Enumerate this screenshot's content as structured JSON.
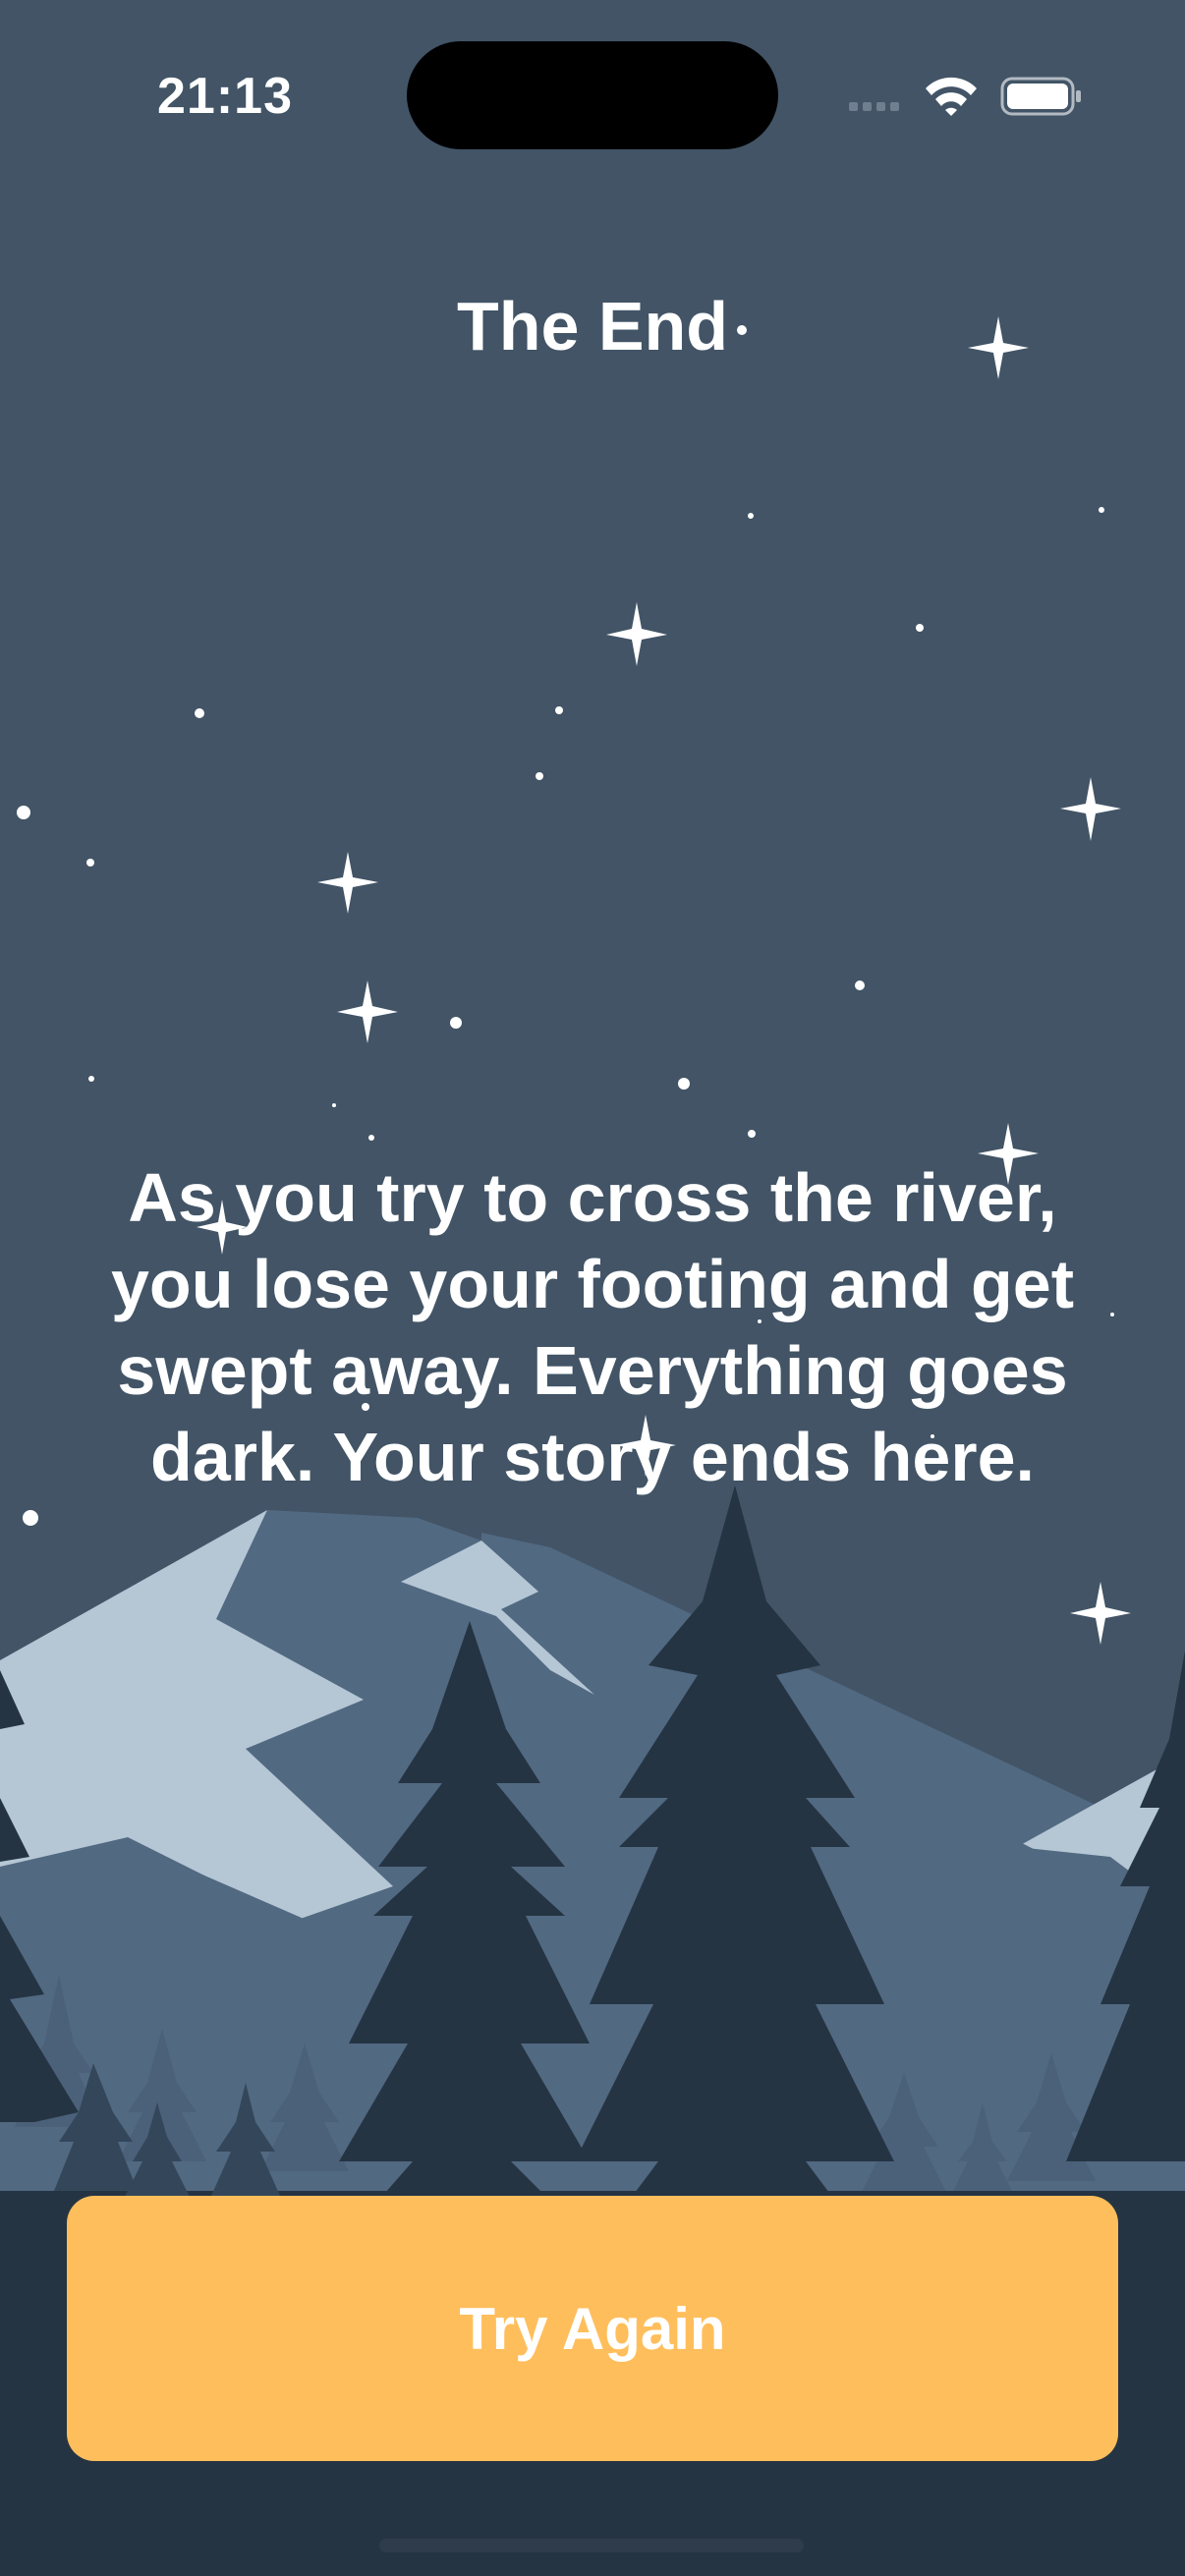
{
  "status_bar": {
    "time": "21:13",
    "icons": [
      "cellular-signal-icon",
      "wifi-icon",
      "battery-icon"
    ]
  },
  "screen": {
    "title": "The End",
    "story_text": "As you try to cross the river, you lose your footing and get swept away. Everything goes dark. Your story ends here.",
    "try_again_label": "Try Again"
  },
  "colors": {
    "sky": "#425466",
    "snow": "#b5c6d5",
    "mountain": "#516981",
    "tree": "#253443",
    "button": "#ffbe5c"
  }
}
